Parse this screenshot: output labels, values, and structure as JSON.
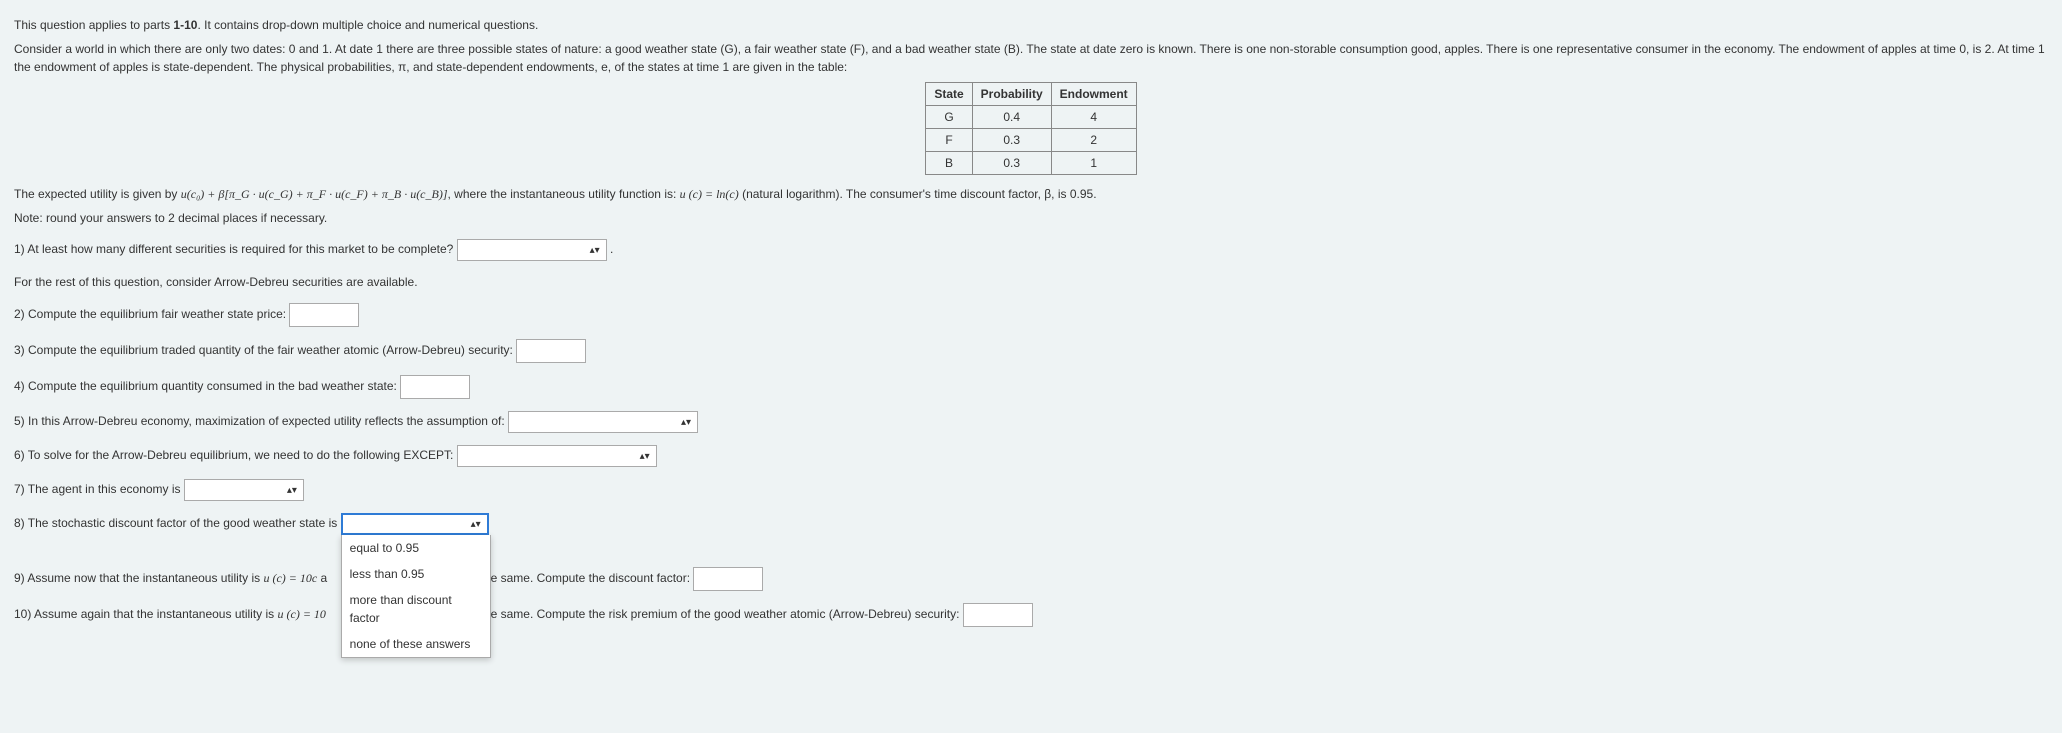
{
  "intro": {
    "leadin": "This question applies to parts ",
    "bold": "1-10",
    "leadout": ". It contains drop-down multiple choice and numerical questions.",
    "scenario": "Consider a world in which there are only two dates: 0 and 1. At date 1 there are three possible states of nature: a good weather state (G), a fair weather state (F), and a bad weather state (B). The state at date zero is known. There is one non-storable consumption good, apples. There is one representative consumer in the economy. The endowment of apples at time 0, is 2. At time 1 the endowment of apples is state-dependent. The physical probabilities, π, and state-dependent endowments, e, of the states at time 1 are given in the table:"
  },
  "table": {
    "headers": [
      "State",
      "Probability",
      "Endowment"
    ],
    "rows": [
      [
        "G",
        "0.4",
        "4"
      ],
      [
        "F",
        "0.3",
        "2"
      ],
      [
        "B",
        "0.3",
        "1"
      ]
    ]
  },
  "eu": {
    "pre": "The expected utility is given by ",
    "formula": "u(c₀) + β[π_G · u(c_G) + π_F · u(c_F) + π_B · u(c_B)]",
    "mid": ", where the instantaneous utility function is: ",
    "formula2": "u (c) = ln(c)",
    "post": " (natural logarithm). The consumer's time discount factor, β, is 0.95.",
    "note": "Note: round your answers to 2 decimal places if necessary."
  },
  "q1": {
    "text": "1) At least how many different securities is required for this market to be complete?",
    "trail": "."
  },
  "q_rest_note": "For the rest of this question, consider Arrow-Debreu securities are available.",
  "q2": "2) Compute the equilibrium fair weather state price:",
  "q3": "3) Compute the equilibrium traded quantity of the fair weather atomic (Arrow-Debreu) security:",
  "q4": "4) Compute the equilibrium quantity consumed in the bad weather state:",
  "q5": "5) In this Arrow-Debreu economy, maximization of expected utility reflects the assumption of:",
  "q6": "6) To solve for the Arrow-Debreu equilibrium, we need to do the following EXCEPT:",
  "q7": "7) The agent in this economy is",
  "q8": {
    "text": "8) The stochastic discount factor of the good weather state is",
    "options": [
      "equal to 0.95",
      "less than 0.95",
      "more than discount factor",
      "none of these answers"
    ]
  },
  "q9": {
    "pre": "9) Assume now that the instantaneous utility is ",
    "formula": "u (c) = 10c",
    "mid1": " a",
    "mid2": "he same. Compute the discount factor:"
  },
  "q10": {
    "pre": "10) Assume again that the instantaneous utility is ",
    "formula": "u (c) = 10",
    "mid2": " the same. Compute the risk premium of the good weather atomic (Arrow-Debreu) security:"
  }
}
